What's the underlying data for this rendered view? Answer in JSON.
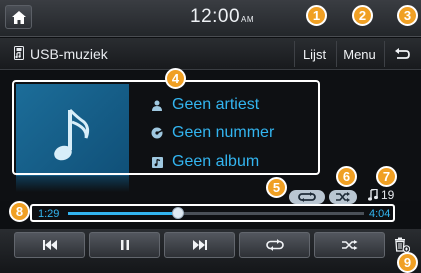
{
  "status_bar": {
    "time": "12:00",
    "ampm": "AM"
  },
  "header": {
    "source": "USB-muziek",
    "list_button": "Lijst",
    "menu_button": "Menu"
  },
  "now_playing": {
    "artist": "Geen artiest",
    "track": "Geen nummer",
    "album": "Geen album"
  },
  "track_count": "19",
  "progress": {
    "elapsed": "1:29",
    "total": "4:04",
    "fraction": 0.37
  },
  "callouts": [
    "1",
    "2",
    "3",
    "4",
    "5",
    "6",
    "7",
    "8",
    "9"
  ],
  "colors": {
    "accent": "#33b5f0",
    "callout": "#f0a024",
    "album_art": "#1c6d99"
  },
  "icons": {
    "home": "home-icon",
    "usb": "usb-icon",
    "back": "back-arrow-icon",
    "artist": "person-icon",
    "track": "music-disc-icon",
    "album": "album-icon",
    "repeat": "repeat-icon",
    "shuffle": "shuffle-icon",
    "note": "music-note-icon",
    "previous": "skip-previous-icon",
    "pause": "pause-icon",
    "next": "skip-next-icon",
    "delete": "trash-icon"
  }
}
